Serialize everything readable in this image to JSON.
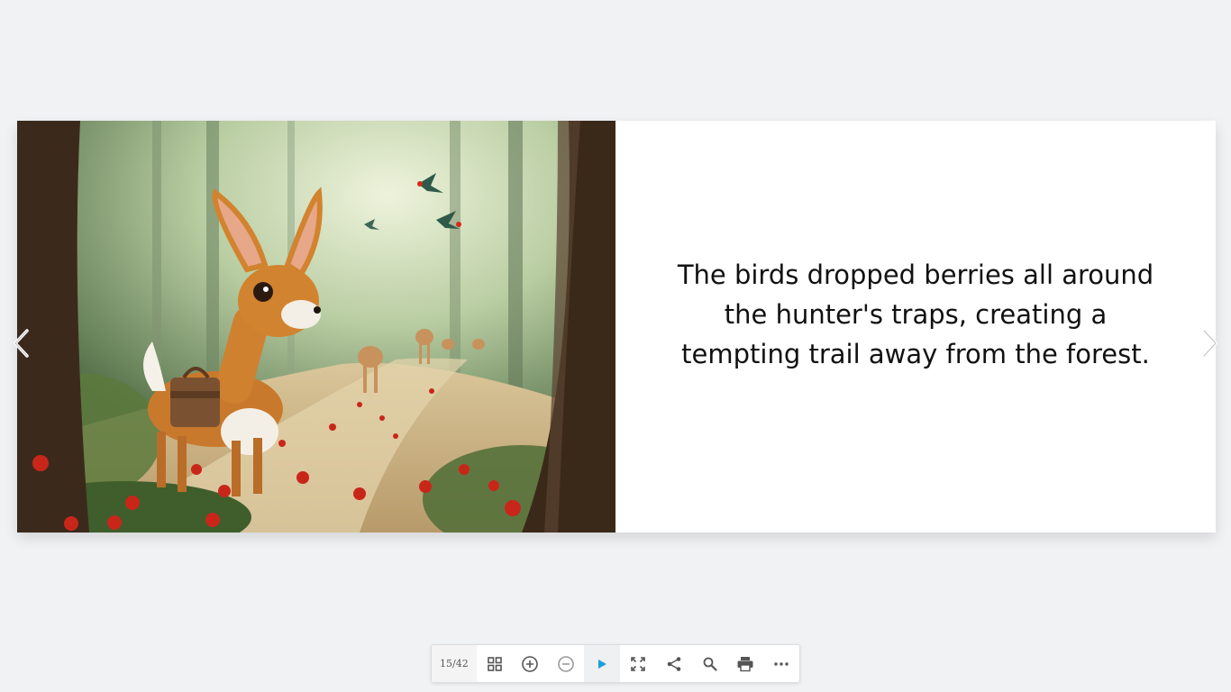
{
  "book": {
    "page_text": "The birds dropped berries all around the hunter's traps, creating a tempting trail away from the forest."
  },
  "toolbar": {
    "page_counter": "15/42"
  },
  "colors": {
    "accent_play": "#1a9fd8",
    "icon": "#555555"
  }
}
